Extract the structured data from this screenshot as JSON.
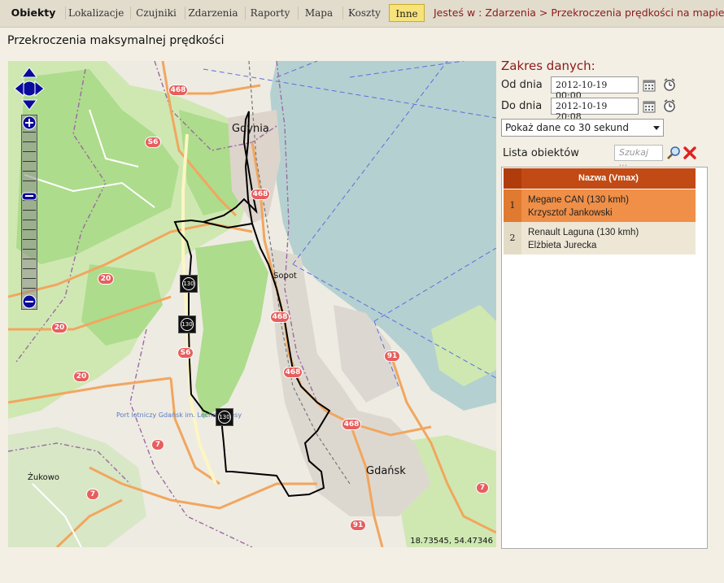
{
  "nav": {
    "tabs": [
      {
        "label": "Obiekty"
      },
      {
        "label": "Lokalizacje"
      },
      {
        "label": "Czujniki"
      },
      {
        "label": "Zdarzenia"
      },
      {
        "label": "Raporty"
      },
      {
        "label": "Mapa"
      },
      {
        "label": "Koszty"
      },
      {
        "label": "Inne"
      }
    ],
    "breadcrumb": "Jesteś w : Zdarzenia > Przekroczenia prędkości na mapie"
  },
  "page_title": "Przekroczenia maksymalnej prędkości",
  "map": {
    "places": {
      "gdynia": "Gdynia",
      "sopot": "Sopot",
      "gdansk": "Gdańsk",
      "zukowo": "Żukowo",
      "port": "Port lotniczy Gdańsk im. Lecha Wałęsy"
    },
    "road_labels": [
      "468",
      "S6",
      "468",
      "20",
      "20",
      "20",
      "S6",
      "468",
      "91",
      "468",
      "468",
      "7",
      "7",
      "7",
      "7",
      "91",
      "S6",
      "91"
    ],
    "markers": [
      "130",
      "130",
      "130"
    ],
    "coordinates": "18.73545, 54.47346"
  },
  "panel": {
    "range_title": "Zakres danych:",
    "from_label": "Od dnia",
    "from_value": "2012-10-19 00:00",
    "to_label": "Do dnia",
    "to_value": "2012-10-19 20:08",
    "interval_select": "Pokaż dane co 30 sekund",
    "list_label": "Lista obiektów",
    "search_placeholder": "Szukaj ...",
    "list_header": "Nazwa (Vmax)",
    "rows": [
      {
        "num": "1",
        "line1": "Megane CAN (130 kmh)",
        "line2": "Krzysztof Jankowski"
      },
      {
        "num": "2",
        "line1": "Renault Laguna (130 kmh)",
        "line2": "Elżbieta Jurecka"
      }
    ]
  },
  "colors": {
    "accent": "#8b1a1a",
    "active_tab": "#f8e37a",
    "list_header": "#c14a15",
    "selected_row": "#ef8f48",
    "sea": "#b5d0d0",
    "forest": "#addc8c",
    "route": "#000000"
  }
}
